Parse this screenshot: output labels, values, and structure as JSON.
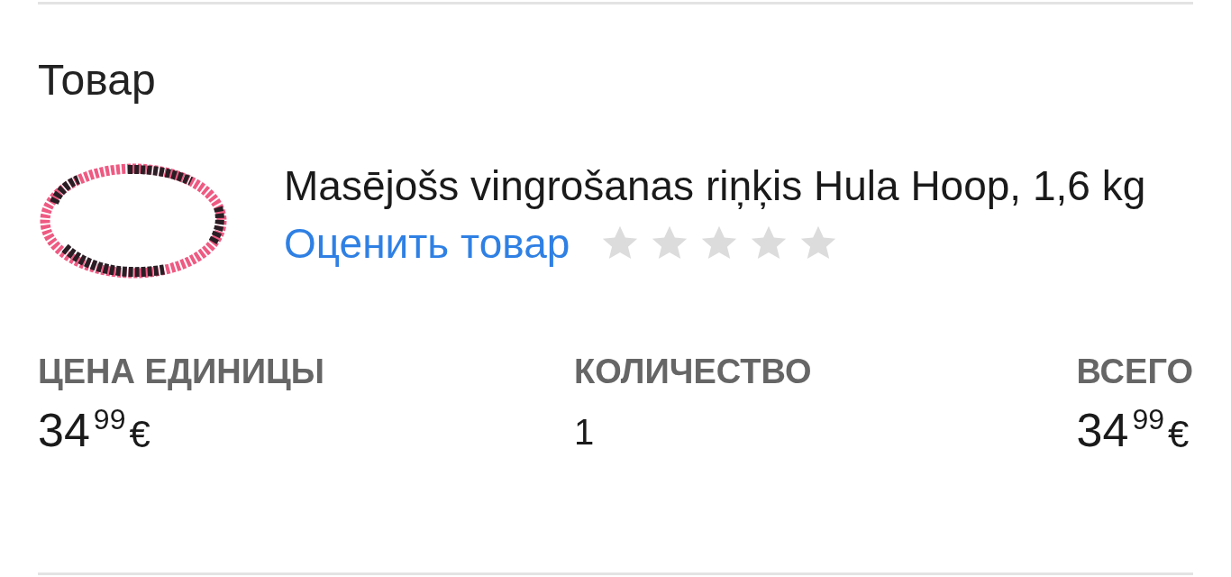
{
  "section_title": "Товар",
  "product": {
    "name": "Masējošs vingrošanas riņķis Hula Hoop, 1,6 kg",
    "rate_link": "Оценить товар",
    "stars": 0
  },
  "columns": [
    {
      "kind": "price",
      "label": "ЦЕНА ЕДИНИЦЫ",
      "whole": "34",
      "fraction": "99",
      "currency": "€"
    },
    {
      "kind": "quantity",
      "label": "КОЛИЧЕСТВО",
      "value": "1"
    },
    {
      "kind": "price",
      "label": "ВСЕГО",
      "whole": "34",
      "fraction": "99",
      "currency": "€"
    }
  ]
}
